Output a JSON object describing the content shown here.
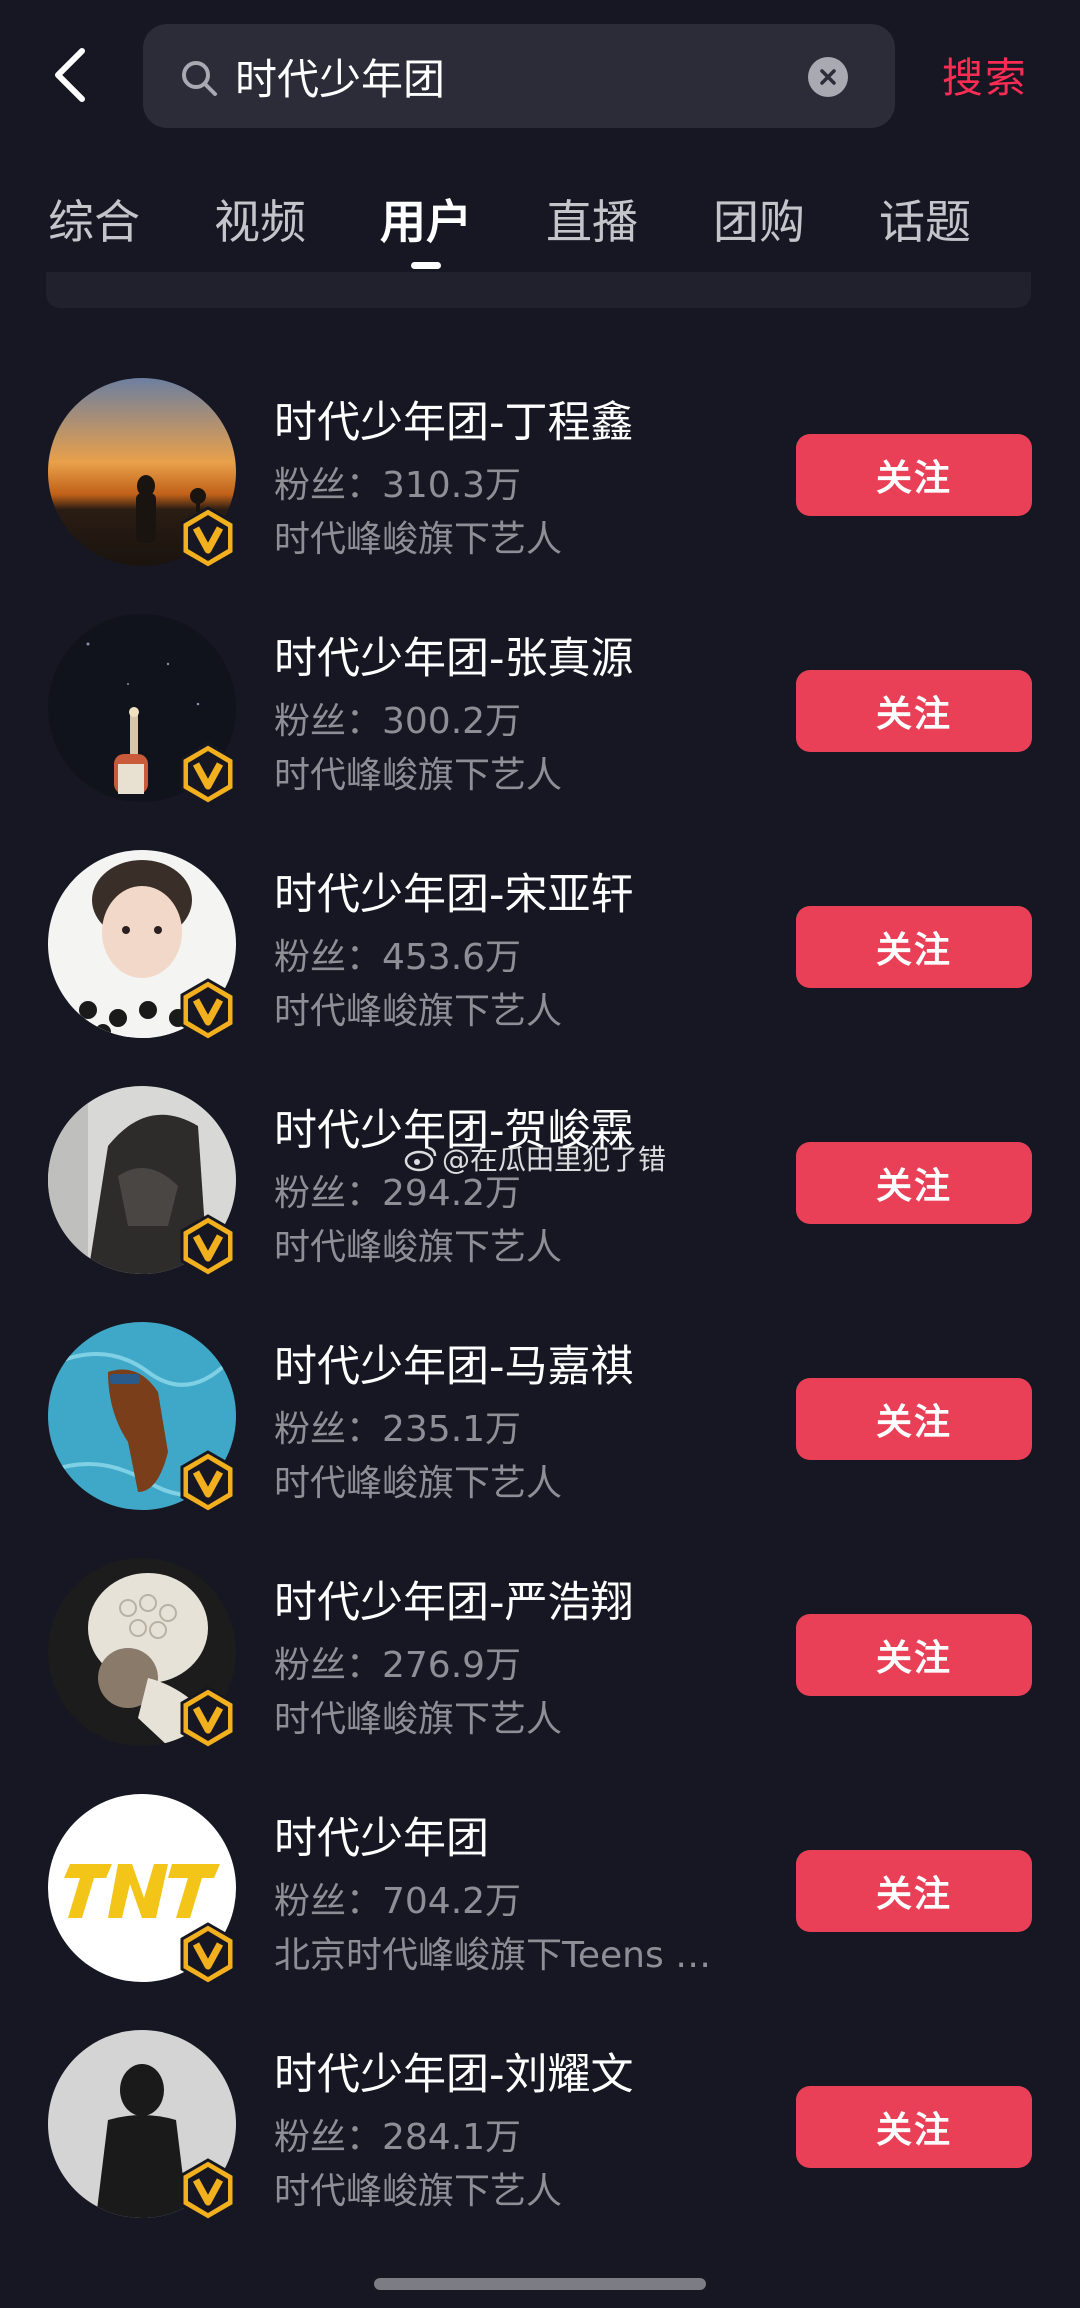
{
  "search": {
    "query": "时代少年团",
    "action_label": "搜索"
  },
  "tabs": [
    {
      "label": "综合",
      "active": false
    },
    {
      "label": "视频",
      "active": false
    },
    {
      "label": "用户",
      "active": true
    },
    {
      "label": "直播",
      "active": false
    },
    {
      "label": "团购",
      "active": false
    },
    {
      "label": "话题",
      "active": false
    }
  ],
  "users": [
    {
      "name": "时代少年团-丁程鑫",
      "fans": "粉丝：310.3万",
      "desc": "时代峰峻旗下艺人",
      "follow_label": "关注",
      "avatar": "sunset-silhouette"
    },
    {
      "name": "时代少年团-张真源",
      "fans": "粉丝：300.2万",
      "desc": "时代峰峻旗下艺人",
      "follow_label": "关注",
      "avatar": "night-sky-hand"
    },
    {
      "name": "时代少年团-宋亚轩",
      "fans": "粉丝：453.6万",
      "desc": "时代峰峻旗下艺人",
      "follow_label": "关注",
      "avatar": "boy-portrait"
    },
    {
      "name": "时代少年团-贺峻霖",
      "fans": "粉丝：294.2万",
      "desc": "时代峰峻旗下艺人",
      "follow_label": "关注",
      "avatar": "dark-figure"
    },
    {
      "name": "时代少年团-马嘉祺",
      "fans": "粉丝：235.1万",
      "desc": "时代峰峻旗下艺人",
      "follow_label": "关注",
      "avatar": "horse-water"
    },
    {
      "name": "时代少年团-严浩翔",
      "fans": "粉丝：276.9万",
      "desc": "时代峰峻旗下艺人",
      "follow_label": "关注",
      "avatar": "knit-hat"
    },
    {
      "name": "时代少年团",
      "fans": "粉丝：704.2万",
      "desc": "北京时代峰峻旗下Teens …",
      "follow_label": "关注",
      "avatar": "tnt-logo"
    },
    {
      "name": "时代少年团-刘耀文",
      "fans": "粉丝：284.1万",
      "desc": "时代峰峻旗下艺人",
      "follow_label": "关注",
      "avatar": "shadow-figure"
    }
  ],
  "watermark": "@在瓜田里犯了错",
  "colors": {
    "background": "#161722",
    "accent": "#fe2c55",
    "follow_button": "#e94057",
    "verified_badge": "#f2b01e"
  }
}
